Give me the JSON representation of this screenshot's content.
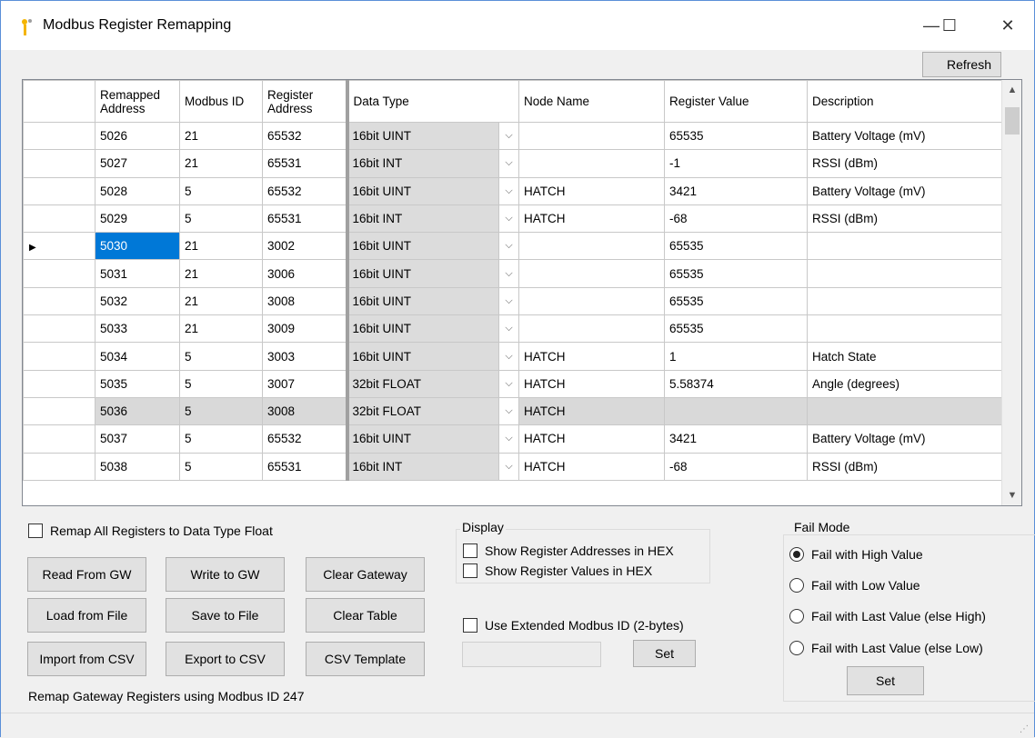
{
  "window": {
    "title": "Modbus Register Remapping",
    "min_glyph": "—",
    "max_glyph": "☐",
    "close_glyph": "✕"
  },
  "toolbar": {
    "refresh_label": "Refresh"
  },
  "grid": {
    "headers": {
      "remapped_address": "Remapped Address",
      "modbus_id": "Modbus ID",
      "register_address": "Register Address",
      "data_type": "Data Type",
      "node_name": "Node Name",
      "register_value": "Register Value",
      "description": "Description"
    },
    "rows": [
      {
        "remap": "5026",
        "id": "21",
        "reg": "65532",
        "type": "16bit UINT",
        "node": "",
        "value": "65535",
        "desc": "Battery Voltage (mV)"
      },
      {
        "remap": "5027",
        "id": "21",
        "reg": "65531",
        "type": "16bit INT",
        "node": "",
        "value": "-1",
        "desc": "RSSI (dBm)"
      },
      {
        "remap": "5028",
        "id": "5",
        "reg": "65532",
        "type": "16bit UINT",
        "node": "HATCH",
        "value": "3421",
        "desc": "Battery Voltage (mV)"
      },
      {
        "remap": "5029",
        "id": "5",
        "reg": "65531",
        "type": "16bit INT",
        "node": "HATCH",
        "value": "-68",
        "desc": "RSSI (dBm)"
      },
      {
        "remap": "5030",
        "id": "21",
        "reg": "3002",
        "type": "16bit UINT",
        "node": "",
        "value": "65535",
        "desc": ""
      },
      {
        "remap": "5031",
        "id": "21",
        "reg": "3006",
        "type": "16bit UINT",
        "node": "",
        "value": "65535",
        "desc": ""
      },
      {
        "remap": "5032",
        "id": "21",
        "reg": "3008",
        "type": "16bit UINT",
        "node": "",
        "value": "65535",
        "desc": ""
      },
      {
        "remap": "5033",
        "id": "21",
        "reg": "3009",
        "type": "16bit UINT",
        "node": "",
        "value": "65535",
        "desc": ""
      },
      {
        "remap": "5034",
        "id": "5",
        "reg": "3003",
        "type": "16bit UINT",
        "node": "HATCH",
        "value": "1",
        "desc": "Hatch State"
      },
      {
        "remap": "5035",
        "id": "5",
        "reg": "3007",
        "type": "32bit FLOAT",
        "node": "HATCH",
        "value": "5.58374",
        "desc": "Angle (degrees)"
      },
      {
        "remap": "5036",
        "id": "5",
        "reg": "3008",
        "type": "32bit FLOAT",
        "node": "HATCH",
        "value": "",
        "desc": ""
      },
      {
        "remap": "5037",
        "id": "5",
        "reg": "65532",
        "type": "16bit UINT",
        "node": "HATCH",
        "value": "3421",
        "desc": "Battery Voltage (mV)"
      },
      {
        "remap": "5038",
        "id": "5",
        "reg": "65531",
        "type": "16bit INT",
        "node": "HATCH",
        "value": "-68",
        "desc": "RSSI (dBm)"
      }
    ],
    "current_row_index": 4,
    "highlighted_row_index": 10
  },
  "options": {
    "remap_all_float_label": "Remap All Registers to Data Type Float",
    "remap_all_float_checked": false
  },
  "buttons": {
    "read_from_gw": "Read From GW",
    "write_to_gw": "Write to GW",
    "clear_gateway": "Clear Gateway",
    "load_from_file": "Load from File",
    "save_to_file": "Save to File",
    "clear_table": "Clear Table",
    "import_from_csv": "Import from CSV",
    "export_to_csv": "Export to CSV",
    "csv_template": "CSV Template",
    "set_extended": "Set",
    "set_fail_mode": "Set"
  },
  "display": {
    "legend": "Display",
    "show_addresses_hex_label": "Show Register Addresses in HEX",
    "show_values_hex_label": "Show Register Values in HEX",
    "show_addresses_hex_checked": false,
    "show_values_hex_checked": false
  },
  "extended": {
    "label": "Use Extended Modbus ID (2-bytes)",
    "checked": false,
    "value": ""
  },
  "fail_mode": {
    "legend": "Fail Mode",
    "options": [
      {
        "label": "Fail with High Value",
        "selected": true
      },
      {
        "label": "Fail with Low Value",
        "selected": false
      },
      {
        "label": "Fail with Last Value (else High)",
        "selected": false
      },
      {
        "label": "Fail with Last Value (else Low)",
        "selected": false
      }
    ]
  },
  "status": {
    "text": "Remap Gateway Registers using Modbus ID 247"
  },
  "colors": {
    "selection": "#0078d7",
    "highlight_row": "#d9d9d9",
    "accent_border": "#5a8fd8"
  }
}
